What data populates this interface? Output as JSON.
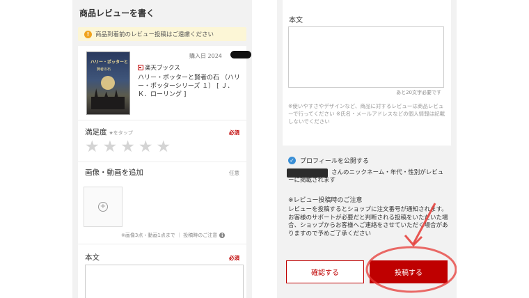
{
  "left": {
    "header": "商品レビューを書く",
    "notice": "商品到着前のレビュー投稿はご遠慮ください",
    "notice_icon": "!",
    "product": {
      "cover_title": "ハリー・ポッターと",
      "cover_subtitle": "賢者の石",
      "purchase_date": "購入日 2024",
      "shop": "楽天ブックス",
      "title": "ハリー・ポッターと賢者の石 （ハリー・ポッターシリーズ １） [ Ｊ．Ｋ．ローリング ]"
    },
    "rating": {
      "label": "満足度",
      "hint": "★をタップ",
      "required": "必須",
      "stars": [
        "★",
        "★",
        "★",
        "★",
        "★"
      ]
    },
    "media": {
      "label": "画像・動画を追加",
      "optional": "任意",
      "plus": "+",
      "note": "※画像3点・動画1点まで ｜ 投稿時のご注意",
      "info": "i"
    },
    "body": {
      "label": "本文",
      "required": "必須"
    }
  },
  "right": {
    "body_label": "本文",
    "remaining": "あと20文字必要です",
    "hint": "※使いやすさやデザインなど、商品に対するレビューは商品レビューで行ってください ※氏名・メールアドレスなどの個人情報は記載しないでください",
    "profile_check": "✓",
    "profile_label": "プロフィールを公開する",
    "profile_desc": "さんのニックネーム・年代・性別がレビューに掲載されます",
    "caution_title": "※レビュー投稿時のご注意",
    "caution_body": "レビューを投稿するとショップに注文番号が通知されます。お客様のサポートが必要だと判断される投稿をいただいた場合、ショップからお客様へご連絡をさせていただく場合がありますので予めご了承ください",
    "confirm_button": "確認する",
    "submit_button": "投稿する"
  },
  "colors": {
    "brand_red": "#bf0000",
    "notice_bg": "#fcf6d6",
    "panel_bg": "#f2f2f2",
    "check_blue": "#3a8fd6",
    "annotation_red": "#e53935"
  }
}
